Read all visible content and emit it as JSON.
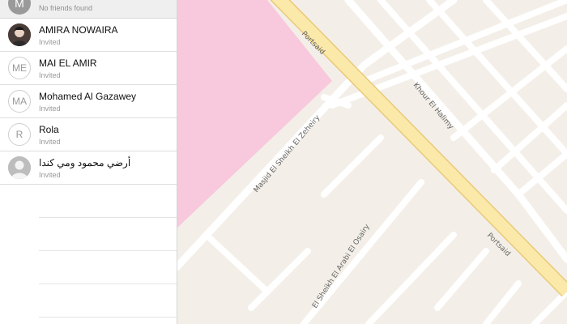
{
  "header": {
    "avatar_initials": "M",
    "status": "No friends found"
  },
  "friends": [
    {
      "name": "AMIRA NOWAIRA",
      "status": "Invited",
      "avatar_type": "photo",
      "initials": ""
    },
    {
      "name": "MAI EL AMIR",
      "status": "Invited",
      "avatar_type": "initials",
      "initials": "ME"
    },
    {
      "name": "Mohamed Al Gazawey",
      "status": "Invited",
      "avatar_type": "initials",
      "initials": "MA"
    },
    {
      "name": "Rola",
      "status": "Invited",
      "avatar_type": "initials",
      "initials": "R"
    },
    {
      "name": "أرضي محمود ومي كندا",
      "status": "Invited",
      "avatar_type": "silhouette",
      "initials": ""
    }
  ],
  "map": {
    "streets": {
      "portsaid_upper": "Portsaid",
      "portsaid_lower": "Portsaid",
      "khour": "Khour El Halimy",
      "masjid": "Masjid El Sheikh El Zeheiry",
      "sheikh": "El Sheikh El Arabi El Osairy"
    },
    "colors": {
      "land": "#f3efe8",
      "park": "#f8c8dc",
      "main_road": "#fbe9a9",
      "main_road_edge": "#e9c97a",
      "side_road": "#ffffff"
    }
  }
}
